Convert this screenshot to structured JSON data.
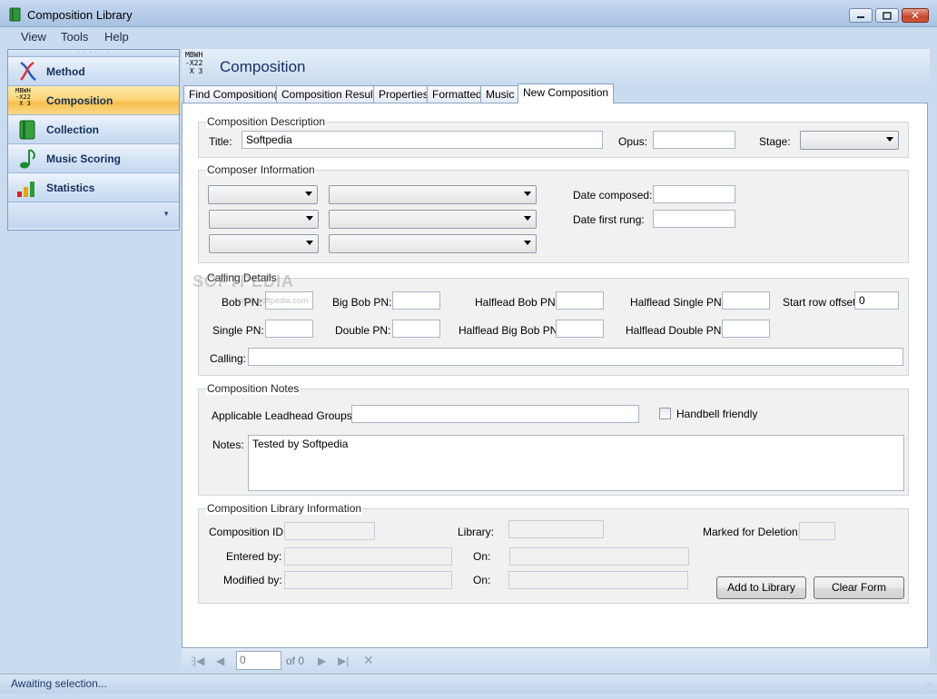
{
  "window": {
    "title": "Composition Library"
  },
  "menu": [
    "View",
    "Tools",
    "Help"
  ],
  "nav": {
    "items": [
      {
        "label": "Method",
        "icon": "method-icon"
      },
      {
        "label": "Composition",
        "icon": "composition-icon",
        "active": true
      },
      {
        "label": "Collection",
        "icon": "book-icon"
      },
      {
        "label": "Music Scoring",
        "icon": "music-note-icon"
      },
      {
        "label": "Statistics",
        "icon": "bar-chart-icon"
      }
    ]
  },
  "header": {
    "title": "Composition",
    "icon_text": "MBWH\n-X22\n X 3"
  },
  "tabs": [
    "Find Composition(s)",
    "Composition Results",
    "Properties",
    "Formatted",
    "Music",
    "New Composition"
  ],
  "description": {
    "group": "Composition Description",
    "title_label": "Title:",
    "title_value": "Softpedia",
    "opus_label": "Opus:",
    "opus_value": "",
    "stage_label": "Stage:",
    "stage_value": ""
  },
  "composer": {
    "group": "Composer Information",
    "date_composed_label": "Date composed:",
    "date_first_rung_label": "Date first rung:"
  },
  "calling": {
    "group": "Calling Details",
    "bob_pn": "Bob PN:",
    "big_bob_pn": "Big Bob PN:",
    "halflead_bob_pn": "Halflead Bob PN:",
    "halflead_single_pn": "Halflead Single PN:",
    "start_row_offset": "Start row offset:",
    "start_row_offset_value": "0",
    "single_pn": "Single PN:",
    "double_pn": "Double PN:",
    "halflead_big_bob_pn": "Halflead Big Bob PN:",
    "halflead_double_pn": "Halflead Double PN:",
    "calling_label": "Calling:"
  },
  "notes": {
    "group": "Composition Notes",
    "leadhead_label": "Applicable Leadhead Groups:",
    "handbell_label": "Handbell friendly",
    "notes_label": "Notes:",
    "notes_value": "Tested by Softpedia"
  },
  "library": {
    "group": "Composition Library Information",
    "composition_id": "Composition ID:",
    "library": "Library:",
    "marked_for_deletion": "Marked for Deletion:",
    "entered_by": "Entered by:",
    "on1": "On:",
    "modified_by": "Modified by:",
    "on2": "On:",
    "add_button": "Add to Library",
    "clear_button": "Clear Form"
  },
  "navigator": {
    "position": "0",
    "of_text": "of 0"
  },
  "watermark": {
    "main": "SOFTPEDIA",
    "sub": "www.softpedia.com"
  },
  "status": {
    "text": "Awaiting selection..."
  }
}
